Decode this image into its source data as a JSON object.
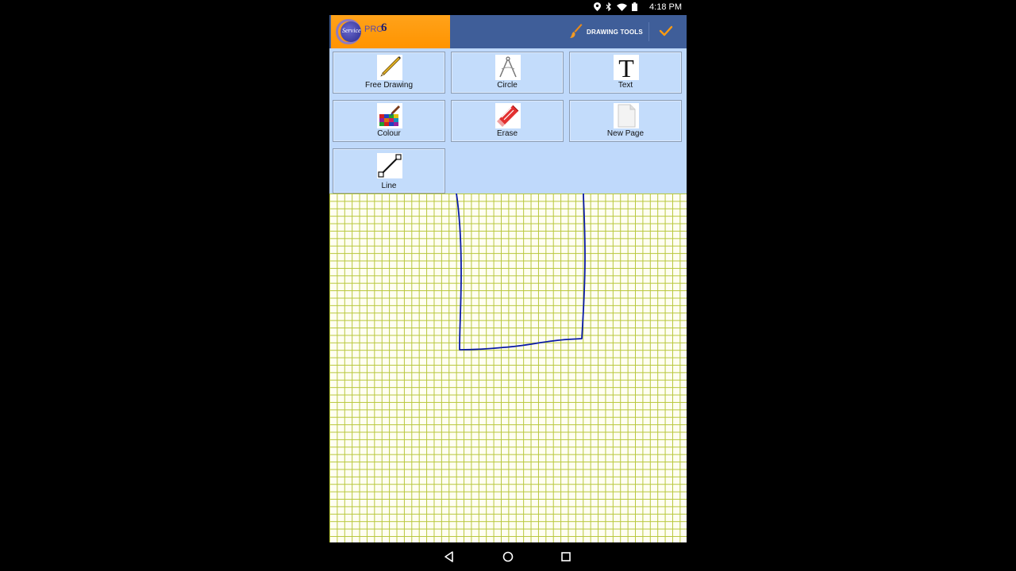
{
  "status": {
    "time": "4:18 PM",
    "icons": [
      "location-icon",
      "bluetooth-icon",
      "wifi-icon",
      "battery-icon"
    ]
  },
  "app": {
    "logo_service": "Service",
    "logo_pro": "PRO",
    "logo_version": "6",
    "drawing_tools_label": "DRAWING TOOLS",
    "accent": "#ff9c0f",
    "appbar_color": "#3f5e99"
  },
  "tools": [
    {
      "label": "Free Drawing",
      "icon": "pencil-icon"
    },
    {
      "label": "Circle",
      "icon": "compass-icon"
    },
    {
      "label": "Text",
      "icon": "text-t-icon"
    },
    {
      "label": "Colour",
      "icon": "palette-icon"
    },
    {
      "label": "Erase",
      "icon": "eraser-icon"
    },
    {
      "label": "New Page",
      "icon": "blank-page-icon"
    },
    {
      "label": "Line",
      "icon": "line-icon"
    }
  ],
  "canvas": {
    "grid_color": "#b8c73b",
    "stroke_color": "#0a1aa8"
  },
  "navigation": {
    "back": "back-icon",
    "home": "home-icon",
    "recents": "recents-icon"
  }
}
